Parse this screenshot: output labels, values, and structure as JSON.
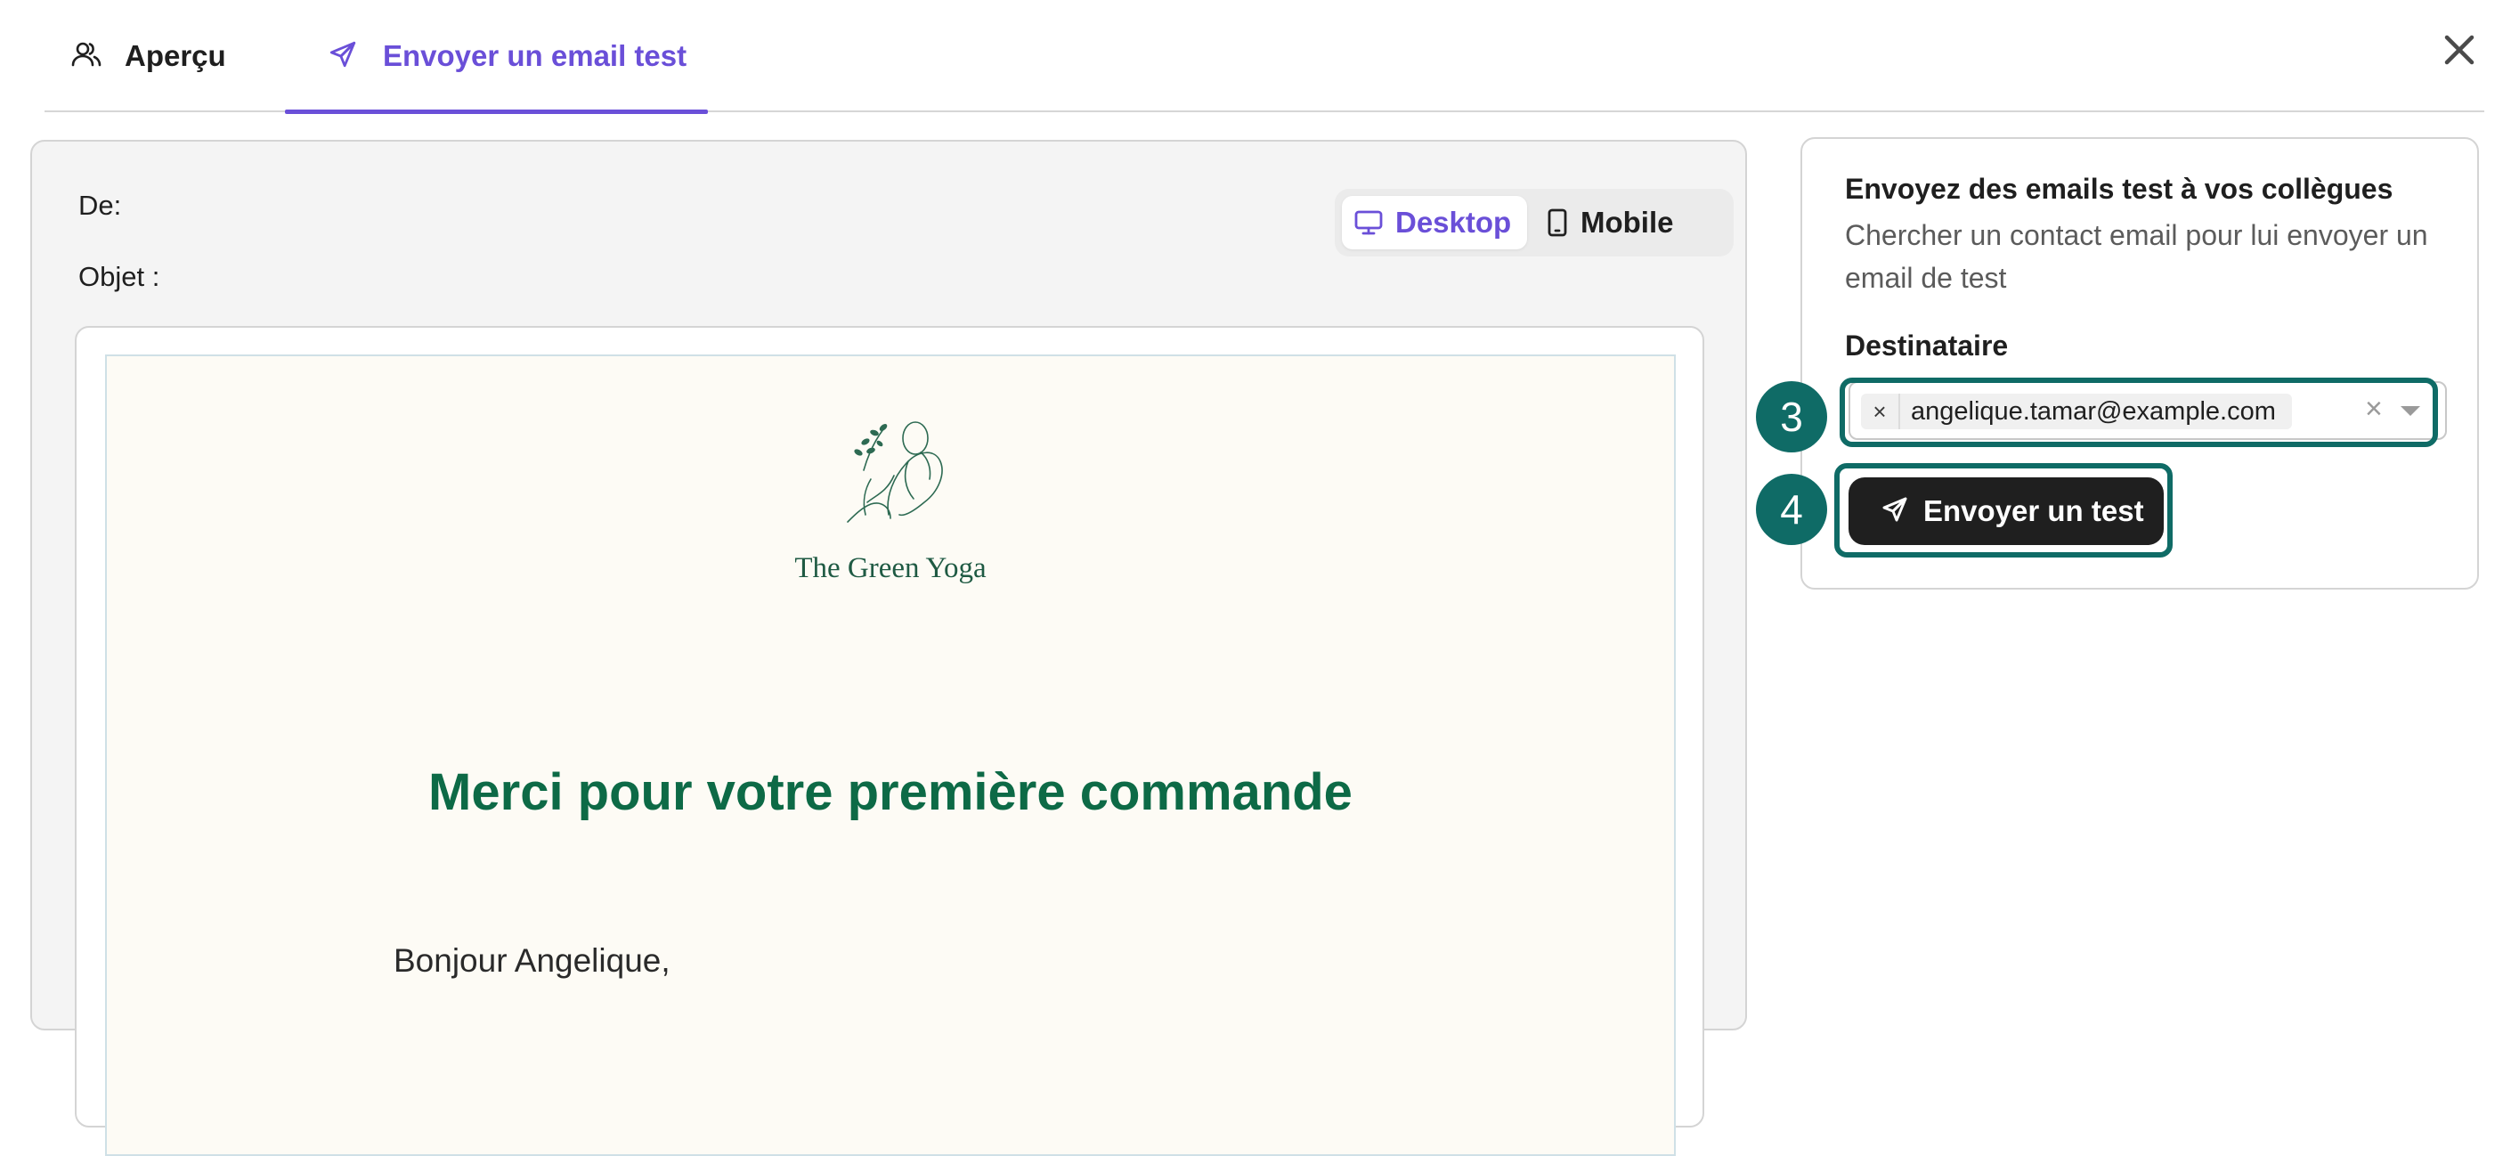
{
  "tabs": [
    {
      "label": "Aperçu",
      "icon": "users-icon",
      "active": false
    },
    {
      "label": "Envoyer un email test",
      "icon": "paper-plane-icon",
      "active": true
    }
  ],
  "close_icon": "close-icon",
  "preview": {
    "from_label": "De:",
    "subject_label": "Objet :",
    "device_toggle": {
      "desktop_label": "Desktop",
      "mobile_label": "Mobile",
      "selected": "Desktop"
    },
    "email": {
      "brand_name": "The Green Yoga",
      "title": "Merci pour votre première commande",
      "greeting": "Bonjour Angelique,"
    }
  },
  "side_panel": {
    "title": "Envoyez des emails test à vos collègues",
    "description": "Chercher un contact email pour lui envoyer un email de test",
    "recipient_label": "Destinataire",
    "recipient_value": "angelique.tamar@example.com",
    "chip_remove": "×",
    "clear_symbol": "×",
    "send_label": "Envoyer un test"
  },
  "steps": [
    "3",
    "4"
  ],
  "colors": {
    "accent": "#6a4fd8",
    "highlight": "#0f6b66",
    "email_title": "#0d6a46",
    "button_bg": "#1f1f1f",
    "email_bg": "#fdfbf5"
  }
}
